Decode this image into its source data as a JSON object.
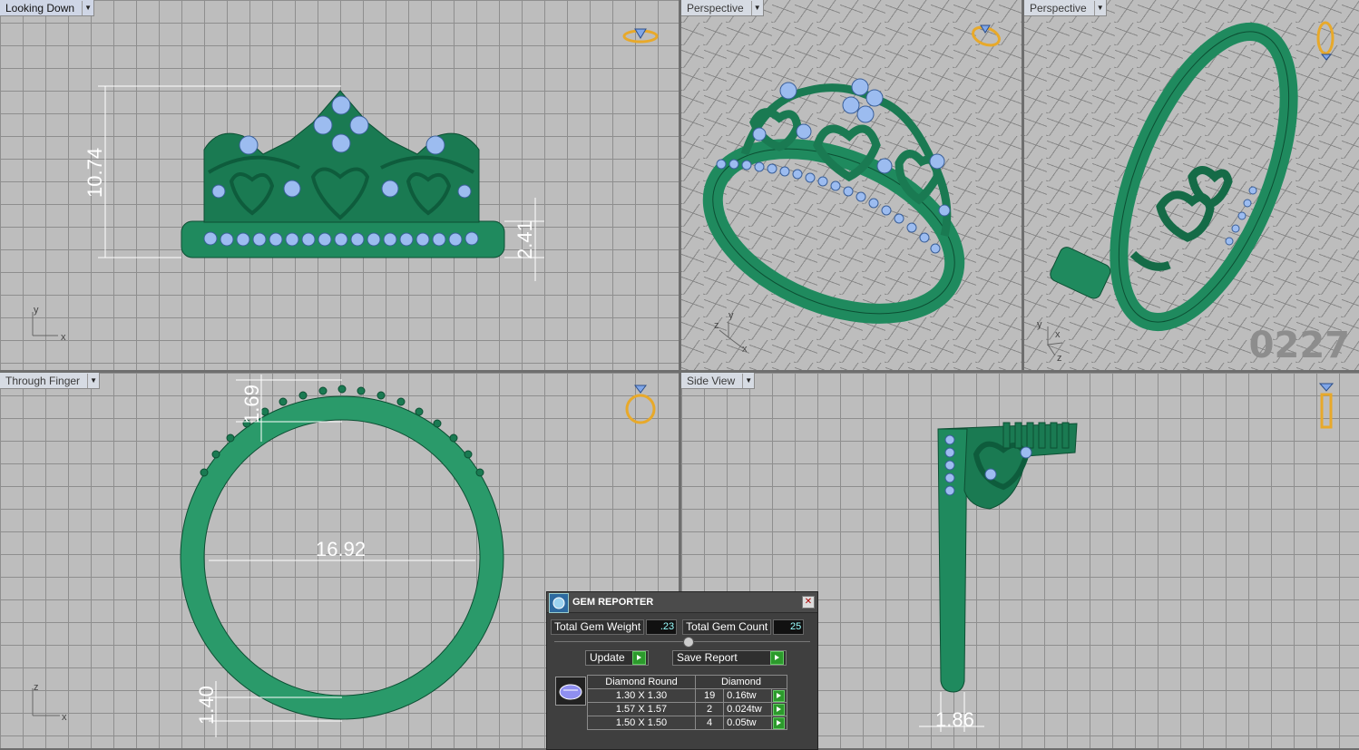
{
  "viewports": {
    "looking_down": {
      "title": "Looking Down",
      "axis_y": "y",
      "axis_x": "x",
      "dim_height": "10.74",
      "dim_band": "2.41"
    },
    "perspective_1": {
      "title": "Perspective",
      "axis_z": "z",
      "axis_y": "y",
      "axis_x": "x"
    },
    "perspective_2": {
      "title": "Perspective",
      "axis_y": "y",
      "axis_x": "x",
      "axis_z": "z",
      "watermark": "0227"
    },
    "through_finger": {
      "title": "Through Finger",
      "axis_z": "z",
      "axis_x": "x",
      "dim_top": "1.69",
      "dim_diameter": "16.92",
      "dim_bottom": "1.40"
    },
    "side_view": {
      "title": "Side View",
      "dim_width": "1.86"
    }
  },
  "gem_reporter": {
    "title": "GEM REPORTER",
    "close_label": "✕",
    "total_weight_label": "Total Gem Weight",
    "total_weight_value": ".23",
    "total_count_label": "Total Gem Count",
    "total_count_value": "25",
    "update_label": "Update",
    "save_report_label": "Save Report",
    "table": {
      "headers": [
        "Diamond Round",
        "Diamond"
      ],
      "rows": [
        {
          "size": "1.30 X 1.30",
          "count": "19",
          "weight": "0.16tw"
        },
        {
          "size": "1.57 X 1.57",
          "count": "2",
          "weight": "0.024tw"
        },
        {
          "size": "1.50 X 1.50",
          "count": "4",
          "weight": "0.05tw"
        }
      ]
    }
  },
  "colors": {
    "metal": "#1f8a5e",
    "metal_dark": "#0f5a3a",
    "gem": "#8fb3e8",
    "background": "#bdbdbd",
    "grid": "#8e8e8e"
  }
}
